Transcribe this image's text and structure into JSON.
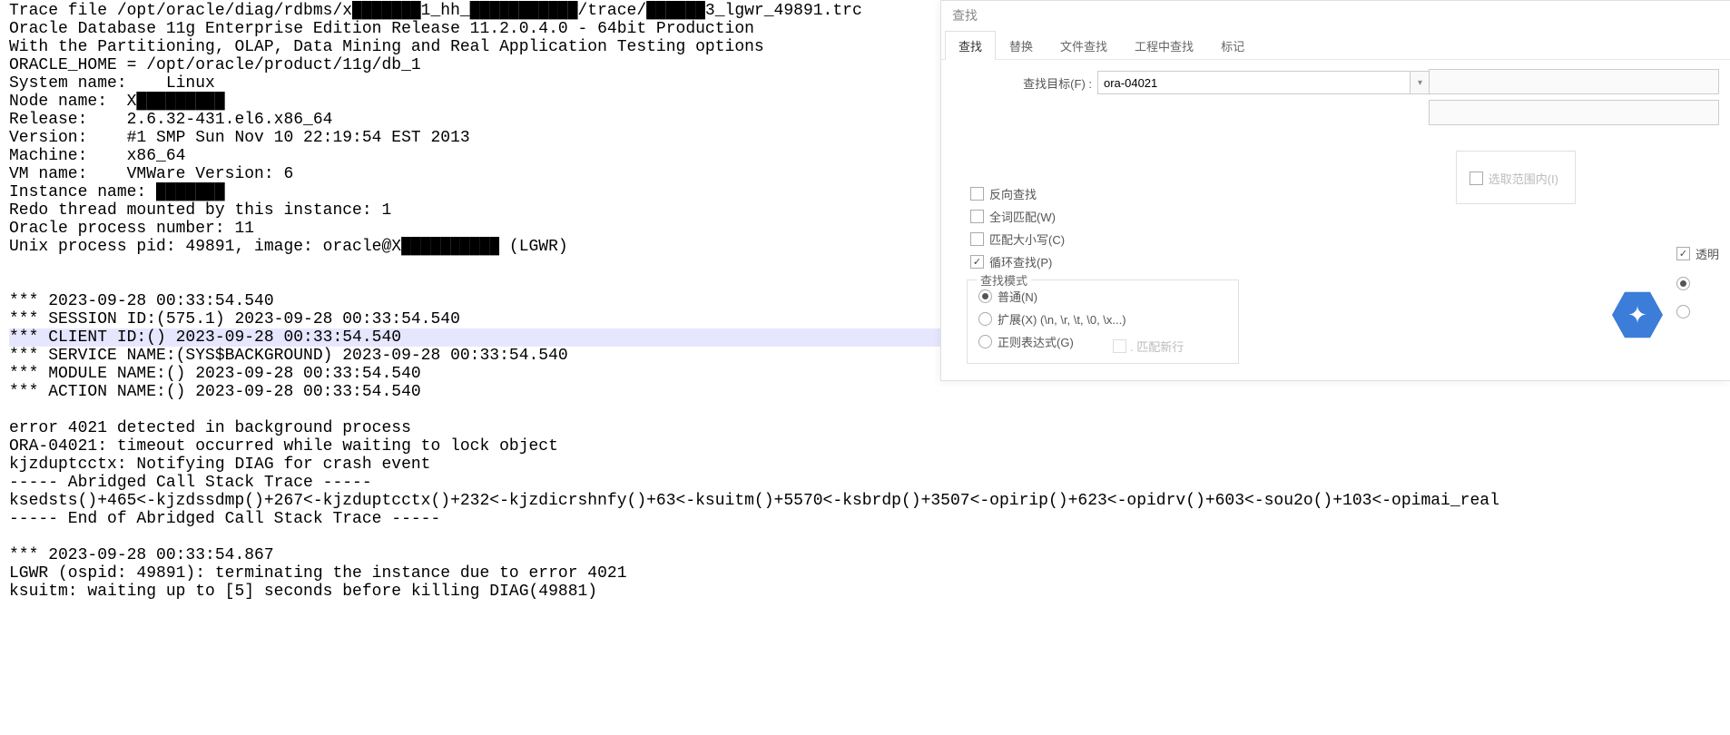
{
  "trace": {
    "lines": [
      "Trace file /opt/oracle/diag/rdbms/x███████1_hh_███████████/trace/██████3_lgwr_49891.trc",
      "Oracle Database 11g Enterprise Edition Release 11.2.0.4.0 - 64bit Production",
      "With the Partitioning, OLAP, Data Mining and Real Application Testing options",
      "ORACLE_HOME = /opt/oracle/product/11g/db_1",
      "System name:    Linux",
      "Node name:  X█████████",
      "Release:    2.6.32-431.el6.x86_64",
      "Version:    #1 SMP Sun Nov 10 22:19:54 EST 2013",
      "Machine:    x86_64",
      "VM name:    VMWare Version: 6",
      "Instance name: ███████",
      "Redo thread mounted by this instance: 1",
      "Oracle process number: 11",
      "Unix process pid: 49891, image: oracle@X██████████ (LGWR)",
      "",
      "",
      "*** 2023-09-28 00:33:54.540",
      "*** SESSION ID:(575.1) 2023-09-28 00:33:54.540",
      "*** CLIENT ID:() 2023-09-28 00:33:54.540",
      "*** SERVICE NAME:(SYS$BACKGROUND) 2023-09-28 00:33:54.540",
      "*** MODULE NAME:() 2023-09-28 00:33:54.540",
      "*** ACTION NAME:() 2023-09-28 00:33:54.540",
      "",
      "error 4021 detected in background process",
      "ORA-04021: timeout occurred while waiting to lock object",
      "kjzduptcctx: Notifying DIAG for crash event",
      "----- Abridged Call Stack Trace -----",
      "ksedsts()+465<-kjzdssdmp()+267<-kjzduptcctx()+232<-kjzdicrshnfy()+63<-ksuitm()+5570<-ksbrdp()+3507<-opirip()+623<-opidrv()+603<-sou2o()+103<-opimai_real",
      "----- End of Abridged Call Stack Trace -----",
      "",
      "*** 2023-09-28 00:33:54.867",
      "LGWR (ospid: 49891): terminating the instance due to error 4021",
      "ksuitm: waiting up to [5] seconds before killing DIAG(49881)"
    ],
    "highlight_index": 18
  },
  "find": {
    "title": "查找",
    "tabs": [
      "查找",
      "替换",
      "文件查找",
      "工程中查找",
      "标记"
    ],
    "active_tab": 0,
    "target_label": "查找目标(F) :",
    "target_value": "ora-04021",
    "scope_label": "选取范围内(I)",
    "checks": {
      "reverse": {
        "label": "反向查找",
        "checked": false
      },
      "whole": {
        "label": "全词匹配(W)",
        "checked": false
      },
      "case": {
        "label": "匹配大小写(C)",
        "checked": false
      },
      "wrap": {
        "label": "循环查找(P)",
        "checked": true
      }
    },
    "mode": {
      "title": "查找模式",
      "normal": "普通(N)",
      "extended": "扩展(X) (\\n, \\r, \\t, \\0, \\x...)",
      "regex": "正则表达式(G)",
      "selected": "normal",
      "newline": ". 匹配新行"
    },
    "transparent": "透明"
  }
}
